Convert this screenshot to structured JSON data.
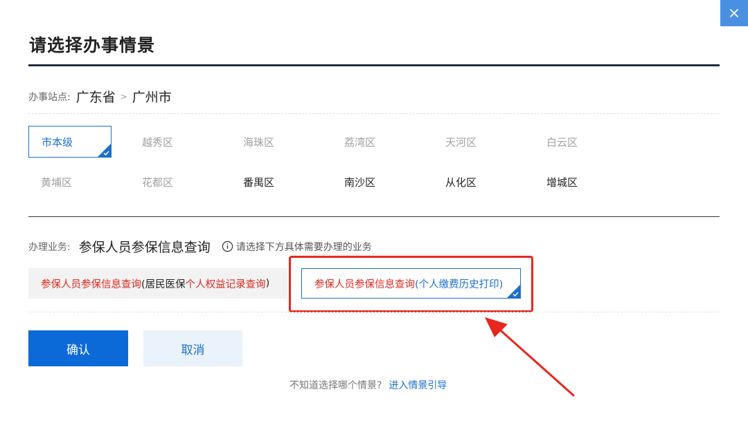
{
  "dialog": {
    "close_icon": "close-icon",
    "title": "请选择办事情景"
  },
  "site": {
    "label": "办事站点:",
    "province": "广东省",
    "separator": ">",
    "city": "广州市"
  },
  "districts": {
    "selected": "市本级",
    "items": [
      {
        "name": "市本级",
        "state": "selected"
      },
      {
        "name": "越秀区",
        "state": "disabled"
      },
      {
        "name": "海珠区",
        "state": "disabled"
      },
      {
        "name": "荔湾区",
        "state": "disabled"
      },
      {
        "name": "天河区",
        "state": "disabled"
      },
      {
        "name": "白云区",
        "state": "disabled"
      },
      {
        "name": "黄埔区",
        "state": "disabled"
      },
      {
        "name": "花都区",
        "state": "disabled"
      },
      {
        "name": "番禺区",
        "state": "enabled"
      },
      {
        "name": "南沙区",
        "state": "enabled"
      },
      {
        "name": "从化区",
        "state": "enabled"
      },
      {
        "name": "增城区",
        "state": "enabled"
      }
    ]
  },
  "business": {
    "label": "办理业务:",
    "value": "参保人员参保信息查询",
    "hint_icon": "info-icon",
    "hint": "请选择下方具体需要办理的业务"
  },
  "options": [
    {
      "part1": "参保人员参保信息查询",
      "part2": "(居民医保",
      "part3": "个人权益记录查询",
      "part4": ")"
    },
    {
      "part1": "参保人员参保信息查询",
      "part2": "(个人缴费历史打印)",
      "selected": true
    }
  ],
  "buttons": {
    "confirm": "确认",
    "cancel": "取消"
  },
  "footer": {
    "question": "不知道选择哪个情景?",
    "link": "进入情景引导"
  },
  "colors": {
    "primary": "#0c6ad8",
    "accent_blue": "#1a6fcf",
    "annotation_red": "#e8261d",
    "title_rule": "#1f2d3d"
  }
}
